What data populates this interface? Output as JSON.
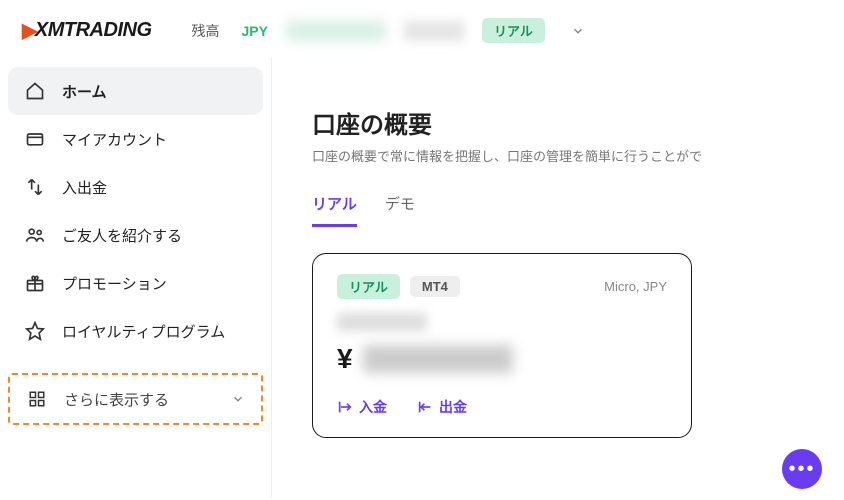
{
  "logo_text": "XMTRADING",
  "topbar": {
    "balance_label": "残高",
    "currency": "JPY",
    "account_badge": "リアル"
  },
  "sidebar": {
    "items": [
      {
        "label": "ホーム"
      },
      {
        "label": "マイアカウント"
      },
      {
        "label": "入出金"
      },
      {
        "label": "ご友人を紹介する"
      },
      {
        "label": "プロモーション"
      },
      {
        "label": "ロイヤルティプログラム"
      }
    ],
    "show_more": "さらに表示する"
  },
  "content": {
    "title": "口座の概要",
    "subtitle": "口座の概要で常に情報を把握し、口座の管理を簡単に行うことがで",
    "tabs": {
      "real": "リアル",
      "demo": "デモ"
    },
    "card": {
      "badge_real": "リアル",
      "badge_platform": "MT4",
      "acct_type": "Micro, JPY",
      "yen": "¥",
      "deposit": "入金",
      "withdraw": "出金"
    }
  }
}
